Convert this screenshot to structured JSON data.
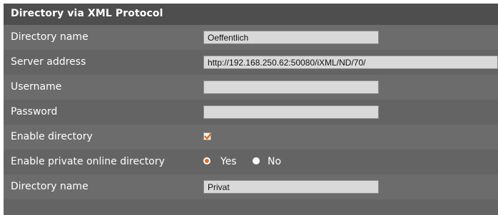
{
  "section": {
    "title": "Directory via XML Protocol"
  },
  "rows": {
    "directory_name_1": {
      "label": "Directory name",
      "value": "Oeffentlich"
    },
    "server_address": {
      "label": "Server address",
      "value": "http://192.168.250.62:50080/iXML/ND/70/"
    },
    "username": {
      "label": "Username",
      "value": ""
    },
    "password": {
      "label": "Password",
      "value": ""
    },
    "enable_directory": {
      "label": "Enable directory",
      "checked": true
    },
    "enable_private": {
      "label": "Enable private online directory",
      "options": [
        {
          "label": "Yes",
          "selected": true
        },
        {
          "label": "No",
          "selected": false
        }
      ]
    },
    "directory_name_2": {
      "label": "Directory name",
      "value": "Privat"
    }
  },
  "colors": {
    "accent": "#e36a1e",
    "panel": "#646464",
    "header": "#4e4e4e"
  }
}
